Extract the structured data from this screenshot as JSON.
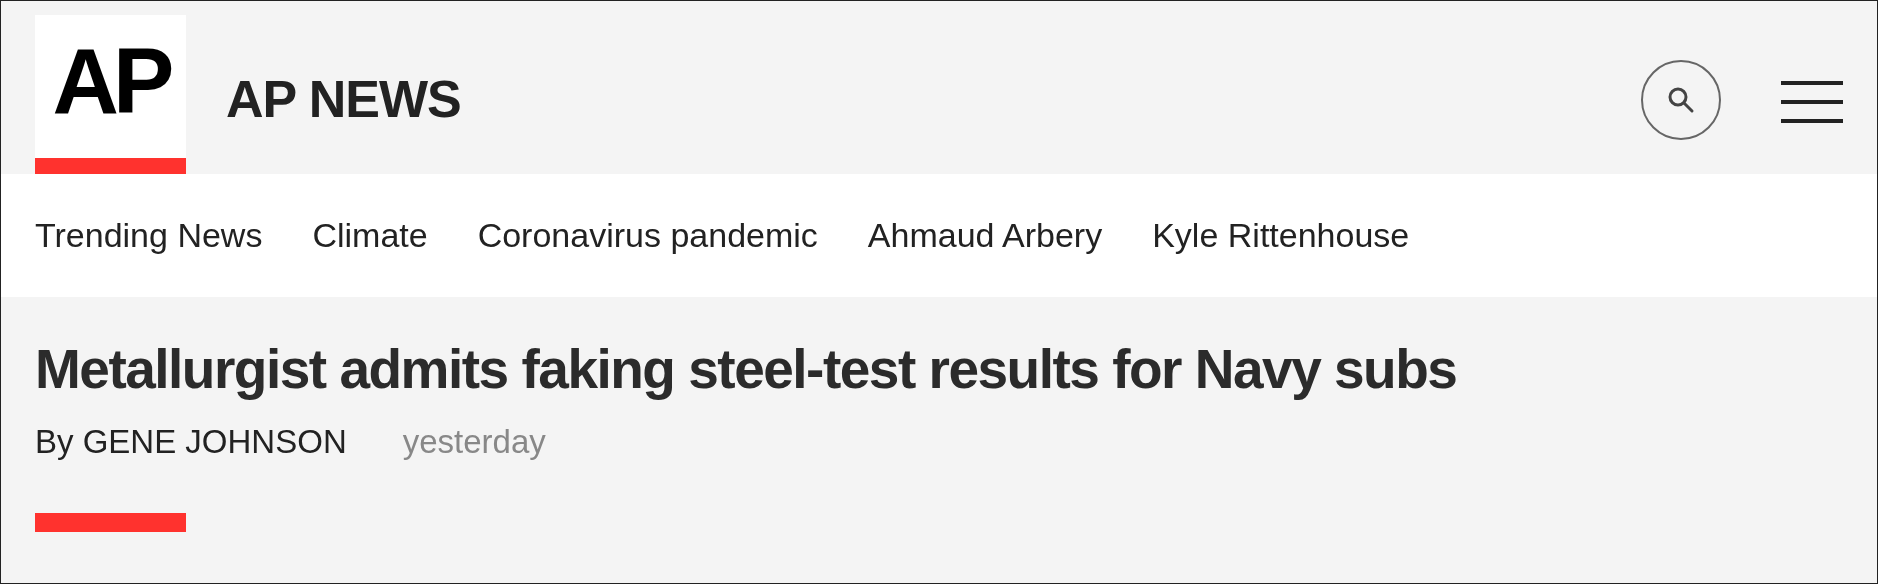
{
  "header": {
    "logo": "AP",
    "site_name": "AP NEWS"
  },
  "nav": [
    {
      "label": "Trending News"
    },
    {
      "label": "Climate"
    },
    {
      "label": "Coronavirus pandemic"
    },
    {
      "label": "Ahmaud Arbery"
    },
    {
      "label": "Kyle Rittenhouse"
    }
  ],
  "article": {
    "headline": "Metallurgist admits faking steel-test results for Navy subs",
    "byline": "By GENE JOHNSON",
    "timestamp": "yesterday"
  }
}
